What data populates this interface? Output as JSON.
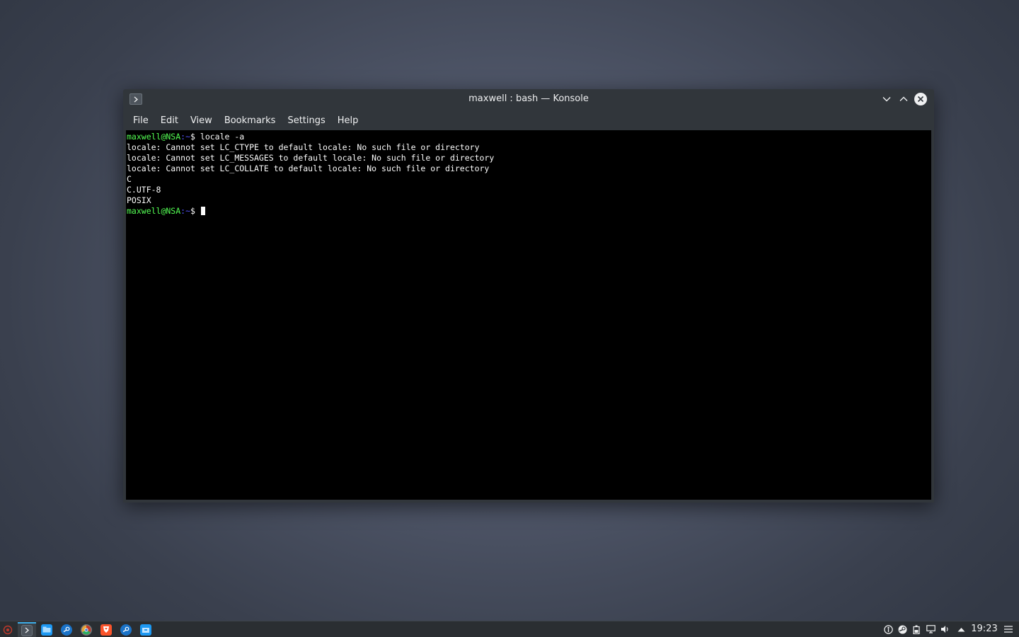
{
  "window": {
    "title": "maxwell : bash — Konsole",
    "menu": [
      "File",
      "Edit",
      "View",
      "Bookmarks",
      "Settings",
      "Help"
    ]
  },
  "terminal": {
    "prompt_user": "maxwell@NSA",
    "prompt_path": ":~",
    "prompt_symbol": "$ ",
    "command": "locale -a",
    "output": [
      "locale: Cannot set LC_CTYPE to default locale: No such file or directory",
      "locale: Cannot set LC_MESSAGES to default locale: No such file or directory",
      "locale: Cannot set LC_COLLATE to default locale: No such file or directory",
      "C",
      "C.UTF-8",
      "POSIX"
    ]
  },
  "taskbar": {
    "clock": "19:23",
    "tasks": [
      "konsole-icon",
      "file-manager-icon",
      "steam-icon",
      "chromium-icon",
      "brave-icon",
      "steam-icon",
      "package-icon"
    ],
    "tray": [
      "accessibility-icon",
      "steam-icon",
      "battery-icon",
      "network-icon",
      "volume-icon",
      "expand-arrow-icon",
      "menu-icon"
    ]
  },
  "colors": {
    "prompt_user": "#54ff54",
    "prompt_path": "#5454ff",
    "accent": "#3daee9",
    "window_bg": "#31363b",
    "terminal_bg": "#000000"
  }
}
